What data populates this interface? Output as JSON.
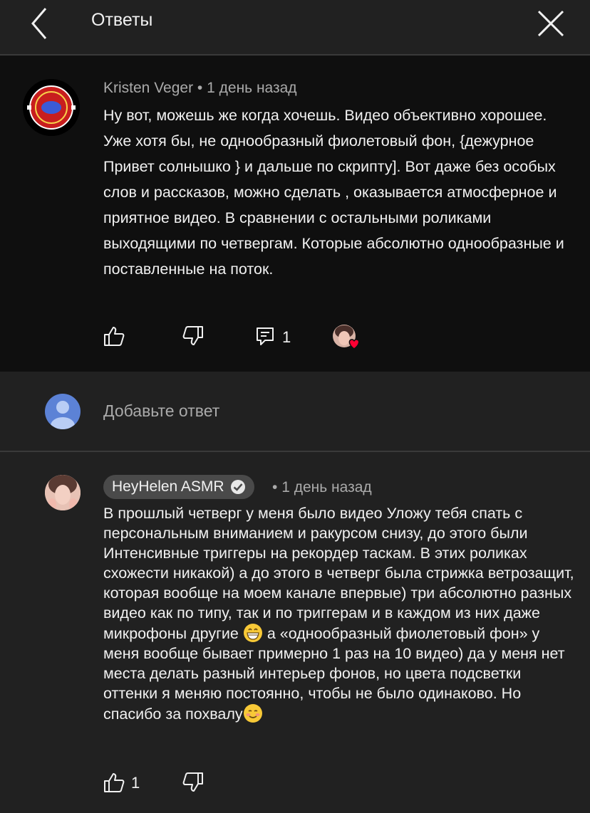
{
  "header": {
    "title": "Ответы"
  },
  "parent_comment": {
    "author": "Kristen Veger",
    "separator": "•",
    "time": "1 день назад",
    "text": "Ну вот, можешь же когда хочешь. Видео объективно хорошее. Уже хотя бы, не однообразный фиолетовый фон, {дежурное Привет солнышко } и дальше по скрипту]. Вот даже без особых слов и рассказов, можно сделать , оказывается атмосферное и приятное видео. В сравнении с остальными роликами выходящими по четвергам. Которые абсолютно однообразные и поставленные на поток.",
    "reply_count": "1",
    "icons": [
      "like-icon",
      "dislike-icon",
      "reply-icon",
      "creator-heart-avatar"
    ]
  },
  "reply_input": {
    "placeholder": "Добавьте ответ"
  },
  "reply": {
    "author": "HeyHelen ASMR",
    "separator": "•",
    "time": "1 день назад",
    "text_part1": "В прошлый четверг у меня было видео Уложу тебя спать с персональным вниманием и ракурсом снизу, до этого были Интенсивные триггеры на рекордер таскам. В этих роликах схожести никакой) а до этого в четверг была стрижка ветрозащит, которая вообще на моем канале впервые) три абсолютно разных видео как по типу, так и по триггерам и в каждом из них даже микрофоны другие ",
    "text_part2": " а «однообразный фиолетовый фон» у меня вообще бывает примерно 1 раз на 10 видео)  да у меня нет места делать разный интерьер фонов, но цвета подсветки оттенки я меняю постоянно, чтобы не было одинаково. Но спасибо за похвалу",
    "like_count": "1",
    "icons": [
      "grinning-emoji-icon",
      "smiling-blush-emoji-icon",
      "verified-check-icon"
    ]
  },
  "colors": {
    "background": "#212121",
    "comment_background": "#0f0f0f",
    "text": "#f1f1f1",
    "secondary_text": "#aaaaaa",
    "heart": "#ff0033"
  }
}
